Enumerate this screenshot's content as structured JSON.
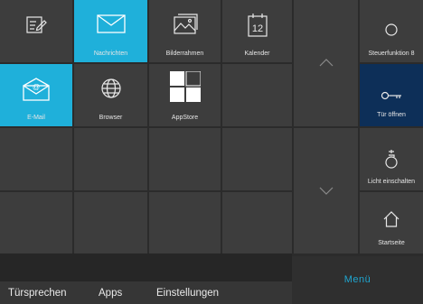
{
  "apps": [
    {
      "id": "notes",
      "label": "",
      "icon": "edit-note-icon",
      "active": false
    },
    {
      "id": "nachrichten",
      "label": "Nachrichten",
      "icon": "envelope-icon",
      "active": true
    },
    {
      "id": "bilderrahmen",
      "label": "Bilderrahmen",
      "icon": "picture-frame-icon",
      "active": false
    },
    {
      "id": "kalender",
      "label": "Kalender",
      "icon": "calendar-icon",
      "active": false,
      "calendar_day": "12"
    },
    {
      "id": "email",
      "label": "E-Mail",
      "icon": "email-at-icon",
      "active": true
    },
    {
      "id": "browser",
      "label": "Browser",
      "icon": "globe-icon",
      "active": false
    },
    {
      "id": "appstore",
      "label": "AppStore",
      "icon": "appstore-grid-icon",
      "active": false
    }
  ],
  "bottom_tabs": [
    "Türsprechen",
    "Apps",
    "Einstellungen"
  ],
  "active_tab": "Apps",
  "side_buttons": [
    {
      "label": "Steuerfunktion 8",
      "icon": "circle-icon"
    },
    {
      "label": "Tür öffnen",
      "icon": "key-icon",
      "highlighted": true
    },
    {
      "label": "Licht einschalten",
      "icon": "light-bulb-icon"
    },
    {
      "label": "Startseite",
      "icon": "home-icon"
    }
  ],
  "menu_label": "Menü",
  "colors": {
    "accent": "#1fb0da",
    "door_button": "#0d2f58",
    "tile": "#3d3d3d",
    "background": "#2b2b2b",
    "menu_text": "#1fa6d0"
  }
}
